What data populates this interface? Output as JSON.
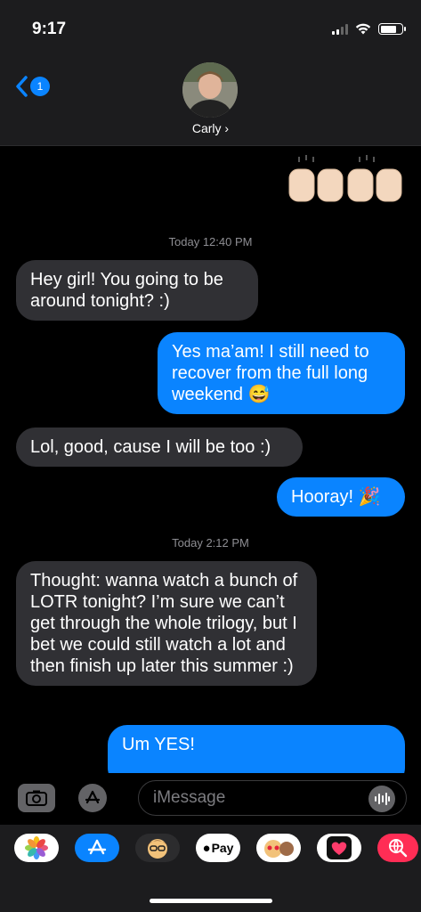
{
  "status_bar": {
    "time": "9:17"
  },
  "nav": {
    "back_badge": "1",
    "contact_name": "Carly ›"
  },
  "chat": {
    "timestamps": [
      {
        "label": "Today",
        "time": "12:40 PM"
      },
      {
        "label": "Today",
        "time": "2:12 PM"
      }
    ],
    "messages": [
      {
        "direction": "in",
        "text": "Hey girl! You going to be around tonight? :)"
      },
      {
        "direction": "out",
        "text": "Yes ma’am! I still need to recover from the full long weekend 😅"
      },
      {
        "direction": "in",
        "text": "Lol, good, cause I will be too :)"
      },
      {
        "direction": "out",
        "text": "Hooray! 🎉"
      },
      {
        "direction": "in",
        "text": "Thought: wanna watch a bunch of LOTR tonight? I’m sure we can’t get through the whole trilogy, but I bet we could still watch a lot and then finish up later this summer :)"
      },
      {
        "direction": "out",
        "text": "Um YES!"
      }
    ]
  },
  "input": {
    "placeholder": "iMessage"
  },
  "app_drawer": {
    "apple_pay_label": "Pay"
  },
  "colors": {
    "accent": "#0a84ff",
    "incoming_bubble": "#303034",
    "bar_bg": "#1c1c1e"
  }
}
